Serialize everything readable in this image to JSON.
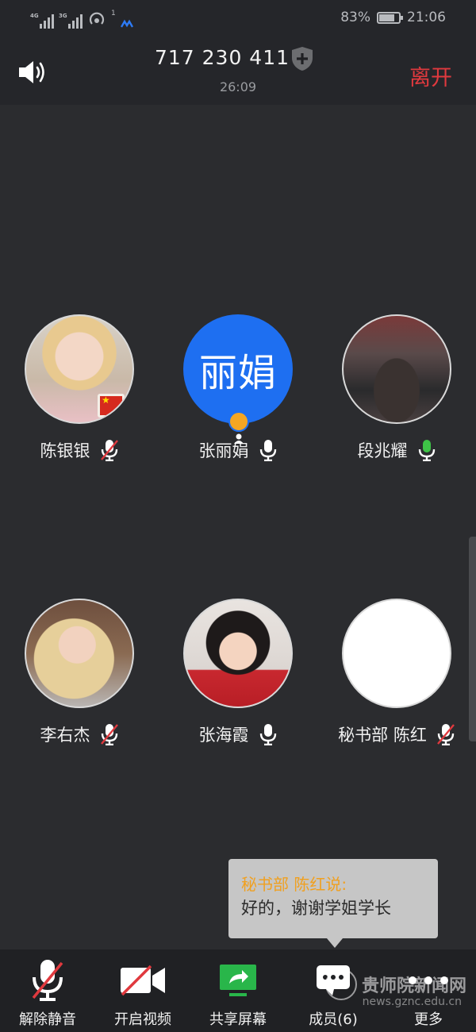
{
  "status_bar": {
    "network1": "4G",
    "network2": "3G",
    "battery": "83%",
    "time": "21:06",
    "notification_count": "1"
  },
  "header": {
    "meeting_id": "717 230 411",
    "elapsed": "26:09",
    "leave_label": "离开"
  },
  "participants": [
    {
      "name": "陈银银",
      "mic": "muted",
      "avatar": "photo"
    },
    {
      "name": "张丽娟",
      "mic": "on",
      "avatar": "initials",
      "initials": "丽娟",
      "host": true
    },
    {
      "name": "段兆耀",
      "mic": "speaking",
      "avatar": "photo"
    },
    {
      "name": "李右杰",
      "mic": "muted",
      "avatar": "photo"
    },
    {
      "name": "张海霞",
      "mic": "on",
      "avatar": "photo"
    },
    {
      "name": "秘书部 陈红",
      "mic": "muted",
      "avatar": "blank"
    }
  ],
  "chat": {
    "sender": "秘书部 陈红说:",
    "message": "好的，谢谢学姐学长"
  },
  "toolbar": {
    "unmute": "解除静音",
    "start_video": "开启视频",
    "share_screen": "共享屏幕",
    "members": "成员(6)",
    "more": "更多"
  },
  "watermark": {
    "text": "贵师院新闻网",
    "url": "news.gznc.edu.cn"
  },
  "colors": {
    "leave": "#e0393e",
    "accent_blue": "#1e6ff1",
    "speaking": "#3ec447",
    "sender": "#f0a020"
  }
}
